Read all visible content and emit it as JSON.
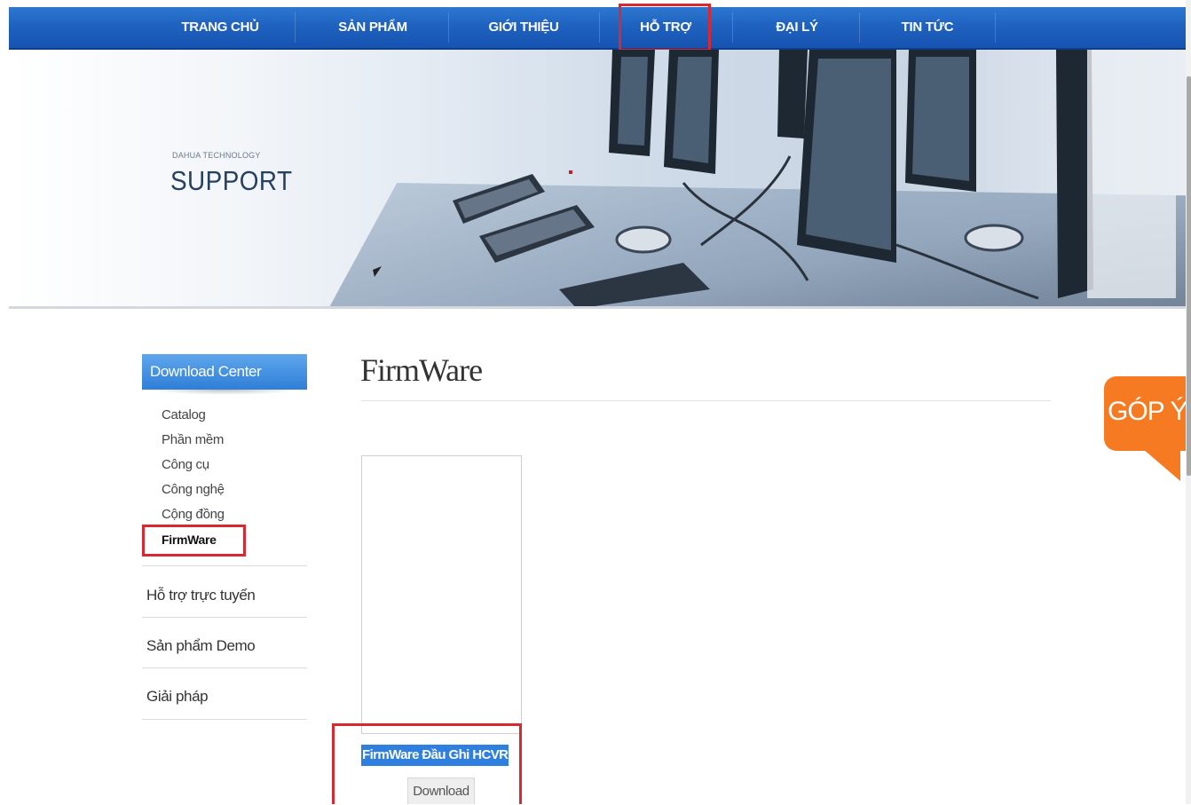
{
  "nav": {
    "items": [
      "TRANG CHỦ",
      "SẢN PHẨM",
      "GIỚI THIỆU",
      "HỖ TRỢ",
      "ĐẠI LÝ",
      "TIN TỨC"
    ],
    "active_index": 3
  },
  "banner": {
    "brand_sub": "DAHUA TECHNOLOGY",
    "title": "SUPPORT"
  },
  "sidebar": {
    "header": "Download Center",
    "sub_items": [
      "Catalog",
      "Phần mềm",
      "Công cụ",
      "Công nghệ",
      "Cộng đồng",
      "FirmWare"
    ],
    "active_sub_index": 5,
    "links": [
      "Hỗ trợ trực tuyến",
      "Sản phẩm Demo",
      "Giải pháp"
    ]
  },
  "main": {
    "title": "FirmWare",
    "items": [
      {
        "name": "FirmWare Đầu Ghi HCVR",
        "button": "Download"
      }
    ]
  },
  "feedback": {
    "label": "GÓP Ý"
  },
  "colors": {
    "nav_blue": "#1f62c0",
    "highlight_red": "#d9282f",
    "feedback_orange": "#f57a22",
    "selection_blue": "#2f7fe0"
  }
}
